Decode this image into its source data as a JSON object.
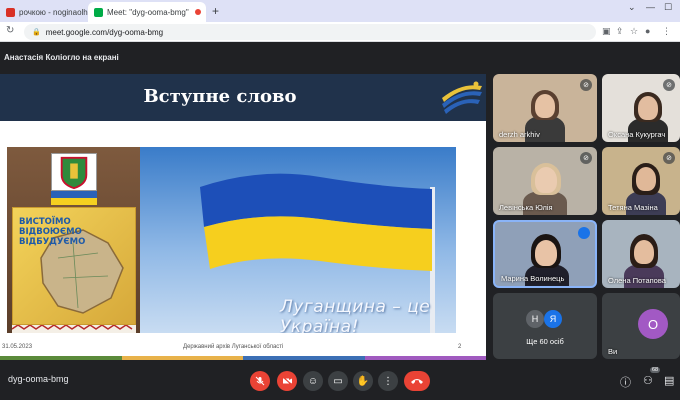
{
  "browser": {
    "tabs": [
      {
        "title": "рочкою - noginaolha@gm",
        "favicon_color": "#d93025"
      },
      {
        "title": "Meet: \"dyg-ooma-bmg\"",
        "favicon_color": "#00ac47"
      }
    ],
    "new_tab_icon": "plus-icon",
    "address": "meet.google.com/dyg-ooma-bmg"
  },
  "presenter_label": "Анастасія Коліогло на екрані",
  "slide": {
    "title": "Вступне слово",
    "poster_motto": [
      "ВИСТОЇМО",
      "ВІДВОЮЄМО",
      "ВІДБУДУЄМО"
    ],
    "flag_caption": "Луганщина – це Україна!",
    "footer_date": "31.05.2023",
    "footer_center": "Державний архів Луганської області",
    "footer_page": "2",
    "stripe_colors": [
      "#5b8a3a",
      "#e8b24a",
      "#3c6fb5",
      "#a05abf"
    ]
  },
  "participants": [
    {
      "name": "derzh arkhiv",
      "muted": true
    },
    {
      "name": "Оксана Кукургач",
      "muted": true
    },
    {
      "name": "Левінська Юлія",
      "muted": true
    },
    {
      "name": "Тетяна Мазіна",
      "muted": false
    },
    {
      "name": "Марина Волинець",
      "muted": false,
      "speaking": true
    },
    {
      "name": "Олена Потапова",
      "muted": false
    },
    {
      "name": "Ще 60 осіб",
      "avatars": [
        "Н",
        "Я"
      ],
      "muted": false
    },
    {
      "name": "Ви",
      "avatar": "О",
      "muted": false
    }
  ],
  "bottom_bar": {
    "meeting_code": "dyg-ooma-bmg",
    "participant_count": "68"
  },
  "colors": {
    "meet_bg": "#202124",
    "control_red": "#ea4335",
    "control_grey": "#3c4043",
    "slide_header": "#20324b",
    "speaking_blue": "#1a73e8"
  }
}
